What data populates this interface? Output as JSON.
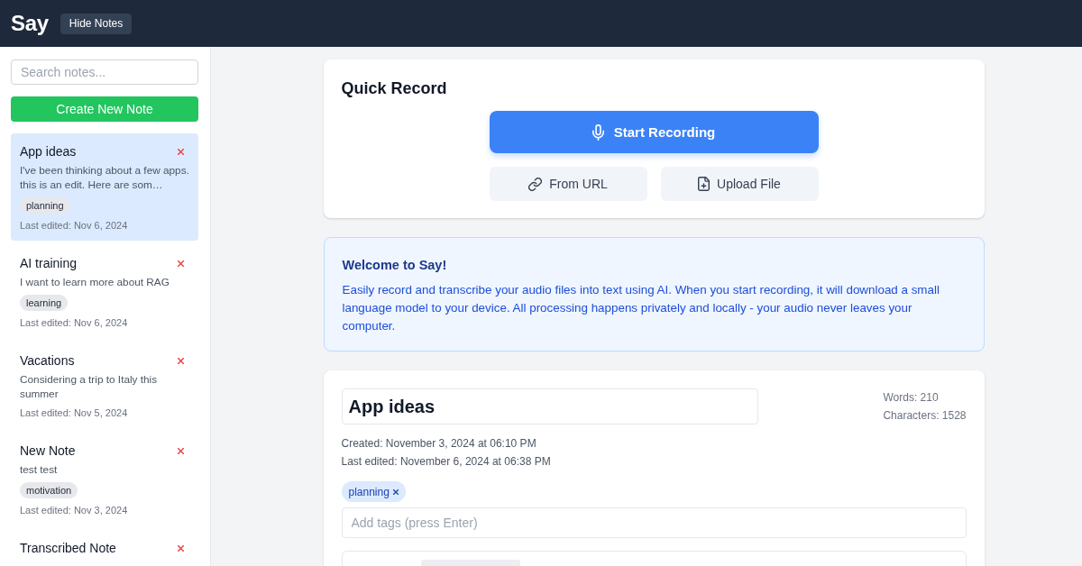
{
  "header": {
    "title": "Say",
    "toggle_button": "Hide Notes"
  },
  "sidebar": {
    "search": {
      "placeholder": "Search notes..."
    },
    "create_button": "Create New Note",
    "notes": [
      {
        "title": "App ideas",
        "preview": "I've been thinking about a few apps. this is an edit. Here are som…",
        "tags": [
          "planning"
        ],
        "last_edited": "Last edited: Nov 6, 2024",
        "selected": true
      },
      {
        "title": "AI training",
        "preview": "I want to learn more about RAG",
        "tags": [
          "learning"
        ],
        "last_edited": "Last edited: Nov 6, 2024",
        "selected": false
      },
      {
        "title": "Vacations",
        "preview": "Considering a trip to Italy this summer",
        "last_edited": "Last edited: Nov 5, 2024",
        "selected": false
      },
      {
        "title": "New Note",
        "preview": "test test",
        "tags": [
          "motivation"
        ],
        "last_edited": "Last edited: Nov 3, 2024",
        "selected": false
      },
      {
        "title": "Transcribed Note",
        "selected": false
      }
    ]
  },
  "quick_record": {
    "title": "Quick Record",
    "record_button": "Start Recording",
    "buttons": [
      {
        "label": "From URL",
        "kind": "link"
      },
      {
        "label": "Upload File",
        "kind": "upload"
      }
    ]
  },
  "welcome": {
    "title": "Welcome to Say!",
    "text": "Easily record and transcribe your audio files into text using AI. When you start recording, it will download a small language model to your device. All processing happens privately and locally - your audio never leaves your computer."
  },
  "editor": {
    "title": "App ideas",
    "stats": [
      "Words: 210",
      "Characters: 1528"
    ],
    "created": "Created: November 3, 2024 at 06:10 PM",
    "last_edited": "Last edited: November 6, 2024 at 06:38 PM",
    "tags": [
      "planning"
    ],
    "tag_input": {
      "placeholder": "Add tags (press Enter)"
    }
  }
}
